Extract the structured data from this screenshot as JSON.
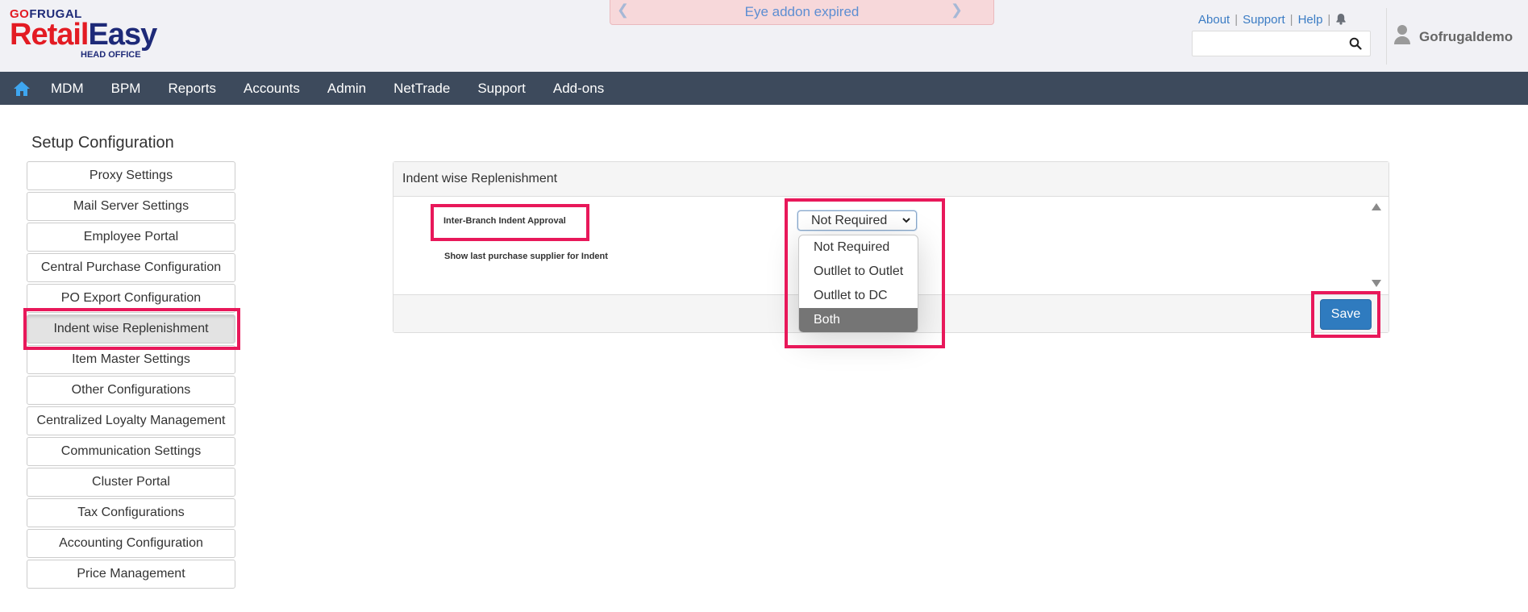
{
  "brand": {
    "top_go": "GO",
    "top_rest": "FRUGAL",
    "main_retail": "Retail",
    "main_easy": "Easy",
    "sub": "HEAD OFFICE"
  },
  "notice": {
    "text": "Eye addon expired"
  },
  "top_links": {
    "about": "About",
    "support": "Support",
    "help": "Help",
    "sep": "|"
  },
  "search": {
    "placeholder": "",
    "value": ""
  },
  "user": {
    "name": "Gofrugaldemo"
  },
  "nav": {
    "items": [
      "MDM",
      "BPM",
      "Reports",
      "Accounts",
      "Admin",
      "NetTrade",
      "Support",
      "Add-ons"
    ]
  },
  "sidebar": {
    "title": "Setup Configuration",
    "items": [
      "Proxy Settings",
      "Mail Server Settings",
      "Employee Portal",
      "Central Purchase Configuration",
      "PO Export Configuration",
      "Indent wise Replenishment",
      "Item Master Settings",
      "Other Configurations",
      "Centralized Loyalty Management",
      "Communication Settings",
      "Cluster Portal",
      "Tax Configurations",
      "Accounting Configuration",
      "Price Management"
    ],
    "active_index": 5
  },
  "panel": {
    "title": "Indent wise Replenishment",
    "fields": {
      "approval_label": "Inter-Branch Indent Approval",
      "supplier_label": "Show last purchase supplier for Indent"
    },
    "select": {
      "value": "Not Required",
      "options": [
        "Not Required",
        "Outllet to Outlet",
        "Outllet to DC",
        "Both"
      ],
      "highlighted_option": "Both"
    },
    "save_label": "Save"
  },
  "colors": {
    "nav_bg": "#3d4a5c",
    "highlight_border": "#e8185a",
    "save_button": "#2f7bbf",
    "brand_red": "#e31b23",
    "brand_navy": "#1e2a78"
  }
}
